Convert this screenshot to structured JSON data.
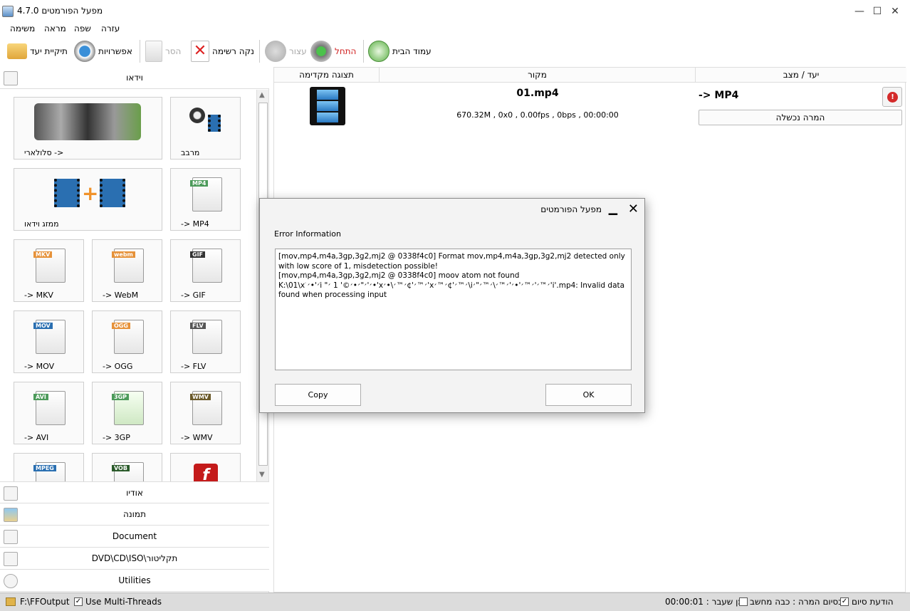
{
  "window": {
    "title": "מפעל הפורמטים 4.7.0",
    "minimize": "—",
    "maximize": "☐",
    "close": "✕"
  },
  "menu": {
    "items": [
      "משימה",
      "מראה",
      "שפה",
      "עזרה"
    ]
  },
  "toolbar": {
    "output_folder": "תיקיית יעד",
    "options": "אפשרויות",
    "remove": "הסר",
    "clear_list": "נקה רשימה",
    "stop": "עצור",
    "start": "התחל",
    "homepage": "עמוד הבית"
  },
  "left_panel": {
    "video_category": "וידאו",
    "tiles": {
      "mobile": "סלולארי ->",
      "multiplex": "מרבב",
      "video_joiner": "ממזג וידאו",
      "mp4": "-> MP4",
      "mkv": "-> MKV",
      "webm": "-> WebM",
      "gif": "-> GIF",
      "mov": "-> MOV",
      "ogg": "-> OGG",
      "flv": "-> FLV",
      "avi": "-> AVI",
      "3gp": "-> 3GP",
      "wmv": "-> WMV"
    },
    "badges": {
      "mp4": "MP4",
      "mkv": "MKV",
      "webm": "webm",
      "gif": "GIF",
      "mov": "MOV",
      "ogg": "OGG",
      "flv": "FLV",
      "avi": "AVI",
      "3gp": "3GP",
      "wmv": "WMV",
      "mpeg": "MPEG",
      "vob": "VOB"
    },
    "categories": [
      "אודיו",
      "תמונה",
      "Document",
      "DVD\\CD\\ISO\\תקליטור",
      "Utilities"
    ]
  },
  "file_list": {
    "columns": {
      "preview": "תצוגה מקדימה",
      "source": "מקור",
      "output_status": "יעד / מצב"
    },
    "rows": [
      {
        "filename": "01.mp4",
        "info": "670.32M , 0x0 , 0.00fps , 0bps , 00:00:00",
        "target": "-> MP4",
        "status": "המרה נכשלה"
      }
    ]
  },
  "status_bar": {
    "output_path": "F:\\FFOutput",
    "multithreads": "Use Multi-Threads",
    "elapsed": "00:00:01 : זמן שעבר",
    "shutdown": "בסיום המרה : כבה מחשב",
    "notify": "הודעת סיום"
  },
  "dialog": {
    "title": "מפעל הפורמטים",
    "heading": "Error Information",
    "lines": [
      "[mov,mp4,m4a,3gp,3g2,mj2 @ 0338f4c0] Format mov,mp4,m4a,3gp,3g2,mj2 detected only with low score of 1, misdetection possible!",
      "[mov,mp4,m4a,3gp,3g2,mj2 @ 0338f4c0] moov atom not found",
      "K:\\01\\ׁx ׳'ׁ•׳i \"׳'׳\"׳•׳©' 1 ׳•'x׳™׳'¢׳™׳\\•׳'x׳™׳'¢׳™׳\\i׳™׳'׳™׳'•׳'׳™׳\\׳™׳\"׳'i'.mp4: Invalid data found when processing input"
    ],
    "copy_button": "Copy",
    "ok_button": "OK"
  }
}
